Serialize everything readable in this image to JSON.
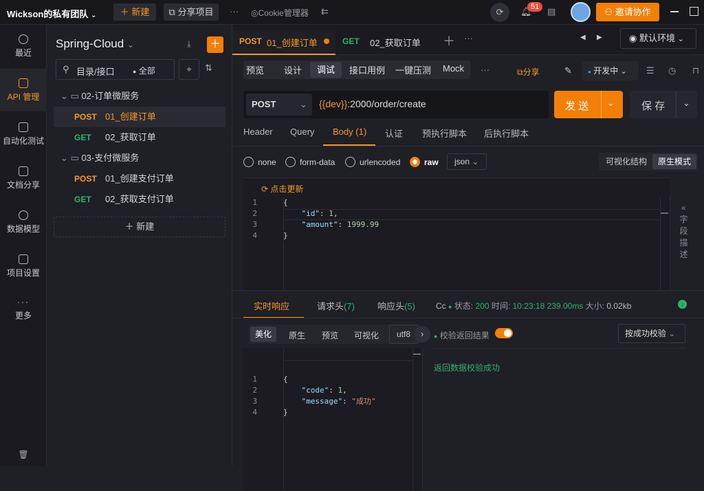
{
  "topbar": {
    "team": "Wickson的私有团队",
    "new": "新建",
    "share": "分享项目",
    "more": "···",
    "cookie": "Cookie管理器",
    "badge": "51",
    "invite": "邀请协作"
  },
  "nav": [
    {
      "label": "最近",
      "icon": "clock-icon"
    },
    {
      "label": "API 管理",
      "icon": "api-icon"
    },
    {
      "label": "自动化测试",
      "icon": "automation-icon"
    },
    {
      "label": "文档分享",
      "icon": "doc-icon"
    },
    {
      "label": "数据模型",
      "icon": "model-icon"
    },
    {
      "label": "项目设置",
      "icon": "settings-icon"
    },
    {
      "label": "更多",
      "icon": "more-icon"
    }
  ],
  "sidebar": {
    "project": "Spring-Cloud",
    "search_placeholder": "目录/接口",
    "filter": "全部",
    "new": "新建",
    "tree": [
      {
        "type": "folder",
        "label": "02-订单微服务"
      },
      {
        "type": "api",
        "method": "POST",
        "label": "01_创建订单",
        "active": true
      },
      {
        "type": "api",
        "method": "GET",
        "label": "02_获取订单"
      },
      {
        "type": "folder",
        "label": "03-支付微服务"
      },
      {
        "type": "api",
        "method": "POST",
        "label": "01_创建支付订单"
      },
      {
        "type": "api",
        "method": "GET",
        "label": "02_获取支付订单"
      }
    ]
  },
  "tabs": [
    {
      "method": "POST",
      "label": "01_创建订单",
      "dirty": true
    },
    {
      "method": "GET",
      "label": "02_获取订单"
    }
  ],
  "env": "默认环境",
  "subtabs": [
    "预览",
    "设计",
    "调试",
    "接口用例",
    "一键压测",
    "Mock"
  ],
  "share_label": "分享",
  "env_selector": "开发中",
  "request": {
    "method": "POST",
    "url_var": "{{dev}}",
    "url_rest": ":2000/order/create",
    "send": "发 送",
    "save": "保 存"
  },
  "req_tabs": [
    "Header",
    "Query",
    "Body",
    "认证",
    "预执行脚本",
    "后执行脚本"
  ],
  "body_count": "(1)",
  "body_types": [
    "none",
    "form-data",
    "urlencoded",
    "raw"
  ],
  "format": "json",
  "mode_visual": "可视化结构",
  "mode_raw": "原生模式",
  "hot_update": "点击更新",
  "request_code": [
    "{",
    "    \"id\": 1,",
    "    \"amount\": 1999.99",
    "}"
  ],
  "field_desc": [
    "字",
    "段",
    "描",
    "述"
  ],
  "resp_tabs": {
    "live": "实时响应",
    "req_headers": "请求头",
    "req_headers_count": "(7)",
    "resp_headers": "响应头",
    "resp_headers_count": "(5)"
  },
  "status": {
    "cc": "Cc",
    "status_label": "状态:",
    "status": "200",
    "time_label": "时间:",
    "time": "10:23:18",
    "duration": "239.00ms",
    "size_label": "大小:",
    "size": "0.02kb"
  },
  "view_tabs": [
    "美化",
    "原生",
    "预览",
    "可视化"
  ],
  "encoding": "utf8",
  "validate_label": "校验返回结果",
  "validate_select": "按成功校验",
  "response_code": [
    "{",
    "    \"code\": 1,",
    "    \"message\": \"成功\"",
    "}"
  ],
  "validate_result": "返回数据校验成功",
  "colors": {
    "accent": "#f47f08",
    "post": "#f59a23",
    "get": "#2fb36b"
  }
}
